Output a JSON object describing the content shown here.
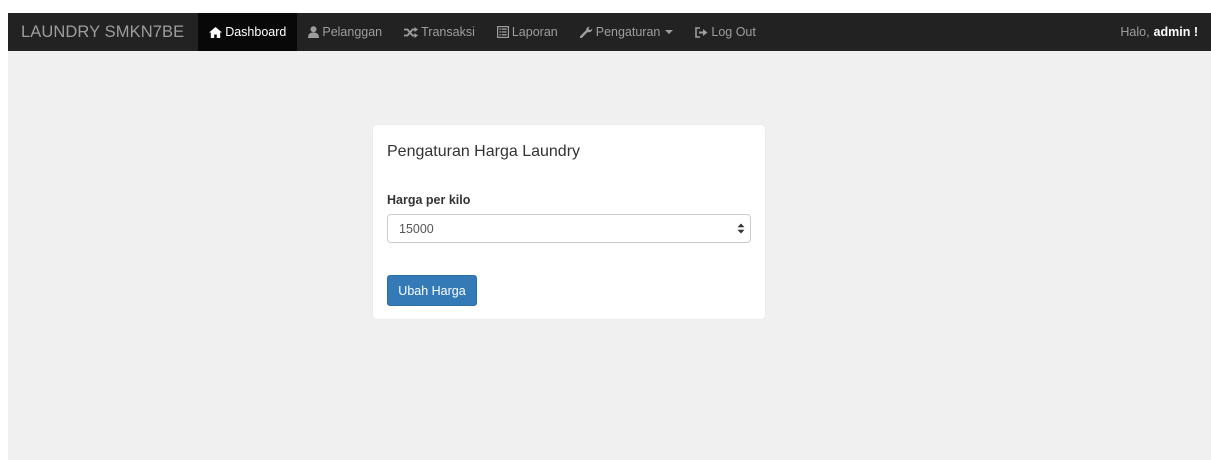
{
  "navbar": {
    "brand": "LAUNDRY SMKN7BE",
    "items": [
      {
        "label": "Dashboard",
        "icon": "home-icon",
        "active": true
      },
      {
        "label": "Pelanggan",
        "icon": "user-icon",
        "active": false
      },
      {
        "label": "Transaksi",
        "icon": "shuffle-icon",
        "active": false
      },
      {
        "label": "Laporan",
        "icon": "list-icon",
        "active": false
      },
      {
        "label": "Pengaturan",
        "icon": "wrench-icon",
        "active": false,
        "dropdown": true
      },
      {
        "label": "Log Out",
        "icon": "logout-icon",
        "active": false
      }
    ],
    "greeting_prefix": "Halo,",
    "greeting_user": "admin !"
  },
  "panel": {
    "title": "Pengaturan Harga Laundry",
    "field_label": "Harga per kilo",
    "field_value": "15000",
    "submit_label": "Ubah Harga"
  },
  "colors": {
    "navbar_bg": "#222222",
    "active_bg": "#080808",
    "page_bg": "#f0f0f0",
    "primary": "#337ab7"
  }
}
